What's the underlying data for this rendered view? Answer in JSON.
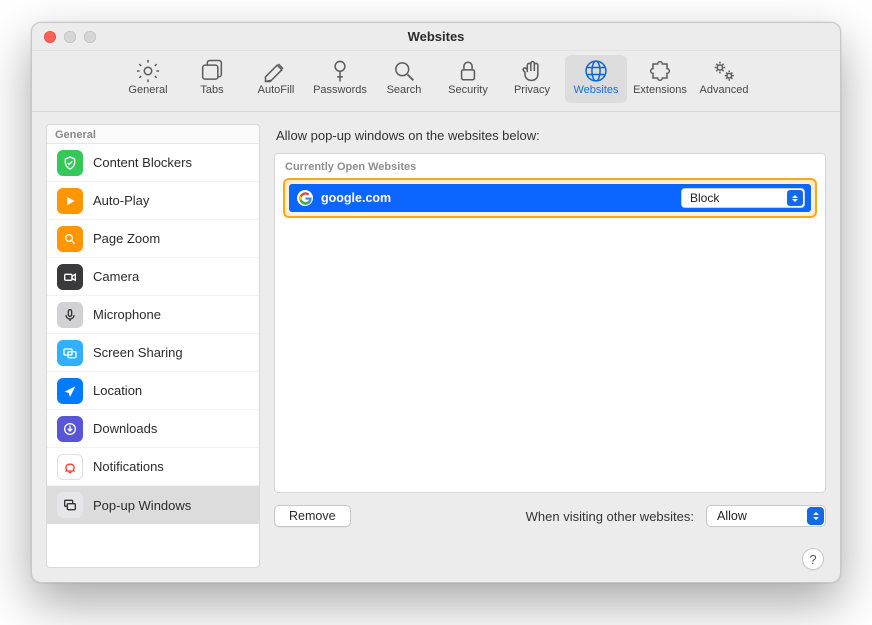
{
  "window": {
    "title": "Websites"
  },
  "toolbar": {
    "items": [
      {
        "id": "general",
        "label": "General"
      },
      {
        "id": "tabs",
        "label": "Tabs"
      },
      {
        "id": "autofill",
        "label": "AutoFill"
      },
      {
        "id": "passwords",
        "label": "Passwords"
      },
      {
        "id": "search",
        "label": "Search"
      },
      {
        "id": "security",
        "label": "Security"
      },
      {
        "id": "privacy",
        "label": "Privacy"
      },
      {
        "id": "websites",
        "label": "Websites",
        "active": true
      },
      {
        "id": "extensions",
        "label": "Extensions"
      },
      {
        "id": "advanced",
        "label": "Advanced"
      }
    ]
  },
  "sidebar": {
    "section_label": "General",
    "items": [
      {
        "id": "content-blockers",
        "label": "Content Blockers",
        "bg": "#34c759"
      },
      {
        "id": "auto-play",
        "label": "Auto-Play",
        "bg": "#ff9500"
      },
      {
        "id": "page-zoom",
        "label": "Page Zoom",
        "bg": "#ff9500"
      },
      {
        "id": "camera",
        "label": "Camera",
        "bg": "#3a3a3c"
      },
      {
        "id": "microphone",
        "label": "Microphone",
        "bg": "#d1d1d6"
      },
      {
        "id": "screen-sharing",
        "label": "Screen Sharing",
        "bg": "#30b0ff"
      },
      {
        "id": "location",
        "label": "Location",
        "bg": "#007aff"
      },
      {
        "id": "downloads",
        "label": "Downloads",
        "bg": "#5856d6"
      },
      {
        "id": "notifications",
        "label": "Notifications",
        "bg": "#ffffff",
        "border": true,
        "red_icon": true
      },
      {
        "id": "popup-windows",
        "label": "Pop-up Windows",
        "bg": "#e5e5ea",
        "active": true
      }
    ]
  },
  "main": {
    "heading": "Allow pop-up windows on the websites below:",
    "list_heading": "Currently Open Websites",
    "sites": [
      {
        "domain": "google.com",
        "setting": "Block",
        "selected": true
      }
    ],
    "remove_label": "Remove",
    "default_label": "When visiting other websites:",
    "default_value": "Allow"
  },
  "help": {
    "symbol": "?"
  }
}
